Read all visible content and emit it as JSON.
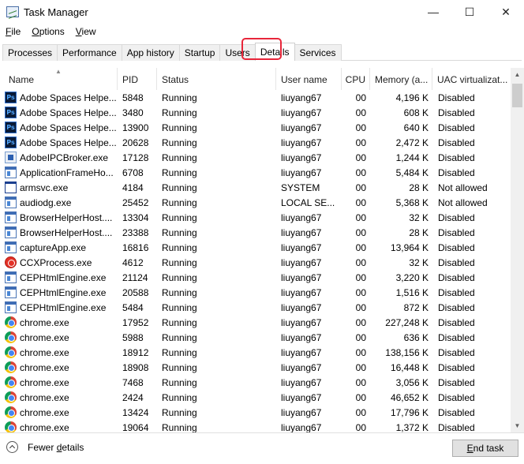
{
  "window": {
    "title": "Task Manager",
    "minimize": "—",
    "maximize": "☐",
    "close": "✕"
  },
  "menu": [
    {
      "pre": "",
      "u": "F",
      "post": "ile"
    },
    {
      "pre": "",
      "u": "O",
      "post": "ptions"
    },
    {
      "pre": "",
      "u": "V",
      "post": "iew"
    }
  ],
  "tabs": [
    "Processes",
    "Performance",
    "App history",
    "Startup",
    "Users",
    "Details",
    "Services"
  ],
  "active_tab": "Details",
  "columns": [
    "Name",
    "PID",
    "Status",
    "User name",
    "CPU",
    "Memory (a...",
    "UAC virtualizat..."
  ],
  "sort_indicator": "▲",
  "rows": [
    {
      "icon": "photoshop-icon",
      "name": "Adobe Spaces Helpe...",
      "pid": "5848",
      "status": "Running",
      "user": "liuyang67",
      "cpu": "00",
      "mem": "4,196 K",
      "uac": "Disabled"
    },
    {
      "icon": "photoshop-icon",
      "name": "Adobe Spaces Helpe...",
      "pid": "3480",
      "status": "Running",
      "user": "liuyang67",
      "cpu": "00",
      "mem": "608 K",
      "uac": "Disabled"
    },
    {
      "icon": "photoshop-icon",
      "name": "Adobe Spaces Helpe...",
      "pid": "13900",
      "status": "Running",
      "user": "liuyang67",
      "cpu": "00",
      "mem": "640 K",
      "uac": "Disabled"
    },
    {
      "icon": "photoshop-icon",
      "name": "Adobe Spaces Helpe...",
      "pid": "20628",
      "status": "Running",
      "user": "liuyang67",
      "cpu": "00",
      "mem": "2,472 K",
      "uac": "Disabled"
    },
    {
      "icon": "acrobat-icon",
      "name": "AdobeIPCBroker.exe",
      "pid": "17128",
      "status": "Running",
      "user": "liuyang67",
      "cpu": "00",
      "mem": "1,244 K",
      "uac": "Disabled"
    },
    {
      "icon": "window-app-icon",
      "name": "ApplicationFrameHo...",
      "pid": "6708",
      "status": "Running",
      "user": "liuyang67",
      "cpu": "00",
      "mem": "5,484 K",
      "uac": "Disabled"
    },
    {
      "icon": "service-window-icon",
      "name": "armsvc.exe",
      "pid": "4184",
      "status": "Running",
      "user": "SYSTEM",
      "cpu": "00",
      "mem": "28 K",
      "uac": "Not allowed"
    },
    {
      "icon": "window-app-icon",
      "name": "audiodg.exe",
      "pid": "25452",
      "status": "Running",
      "user": "LOCAL SE...",
      "cpu": "00",
      "mem": "5,368 K",
      "uac": "Not allowed"
    },
    {
      "icon": "window-app-icon",
      "name": "BrowserHelperHost....",
      "pid": "13304",
      "status": "Running",
      "user": "liuyang67",
      "cpu": "00",
      "mem": "32 K",
      "uac": "Disabled"
    },
    {
      "icon": "window-app-icon",
      "name": "BrowserHelperHost....",
      "pid": "23388",
      "status": "Running",
      "user": "liuyang67",
      "cpu": "00",
      "mem": "28 K",
      "uac": "Disabled"
    },
    {
      "icon": "window-app-icon",
      "name": "captureApp.exe",
      "pid": "16816",
      "status": "Running",
      "user": "liuyang67",
      "cpu": "00",
      "mem": "13,964 K",
      "uac": "Disabled"
    },
    {
      "icon": "creative-cloud-icon",
      "name": "CCXProcess.exe",
      "pid": "4612",
      "status": "Running",
      "user": "liuyang67",
      "cpu": "00",
      "mem": "32 K",
      "uac": "Disabled"
    },
    {
      "icon": "window-app-icon",
      "name": "CEPHtmlEngine.exe",
      "pid": "21124",
      "status": "Running",
      "user": "liuyang67",
      "cpu": "00",
      "mem": "3,220 K",
      "uac": "Disabled"
    },
    {
      "icon": "window-app-icon",
      "name": "CEPHtmlEngine.exe",
      "pid": "20588",
      "status": "Running",
      "user": "liuyang67",
      "cpu": "00",
      "mem": "1,516 K",
      "uac": "Disabled"
    },
    {
      "icon": "window-app-icon",
      "name": "CEPHtmlEngine.exe",
      "pid": "5484",
      "status": "Running",
      "user": "liuyang67",
      "cpu": "00",
      "mem": "872 K",
      "uac": "Disabled"
    },
    {
      "icon": "chrome-icon",
      "name": "chrome.exe",
      "pid": "17952",
      "status": "Running",
      "user": "liuyang67",
      "cpu": "00",
      "mem": "227,248 K",
      "uac": "Disabled"
    },
    {
      "icon": "chrome-icon",
      "name": "chrome.exe",
      "pid": "5988",
      "status": "Running",
      "user": "liuyang67",
      "cpu": "00",
      "mem": "636 K",
      "uac": "Disabled"
    },
    {
      "icon": "chrome-icon",
      "name": "chrome.exe",
      "pid": "18912",
      "status": "Running",
      "user": "liuyang67",
      "cpu": "00",
      "mem": "138,156 K",
      "uac": "Disabled"
    },
    {
      "icon": "chrome-icon",
      "name": "chrome.exe",
      "pid": "18908",
      "status": "Running",
      "user": "liuyang67",
      "cpu": "00",
      "mem": "16,448 K",
      "uac": "Disabled"
    },
    {
      "icon": "chrome-icon",
      "name": "chrome.exe",
      "pid": "7468",
      "status": "Running",
      "user": "liuyang67",
      "cpu": "00",
      "mem": "3,056 K",
      "uac": "Disabled"
    },
    {
      "icon": "chrome-icon",
      "name": "chrome.exe",
      "pid": "2424",
      "status": "Running",
      "user": "liuyang67",
      "cpu": "00",
      "mem": "46,652 K",
      "uac": "Disabled"
    },
    {
      "icon": "chrome-icon",
      "name": "chrome.exe",
      "pid": "13424",
      "status": "Running",
      "user": "liuyang67",
      "cpu": "00",
      "mem": "17,796 K",
      "uac": "Disabled"
    },
    {
      "icon": "chrome-icon",
      "name": "chrome.exe",
      "pid": "19064",
      "status": "Running",
      "user": "liuyang67",
      "cpu": "00",
      "mem": "1,372 K",
      "uac": "Disabled"
    }
  ],
  "footer": {
    "fewer_pre": "Fewer ",
    "fewer_u": "d",
    "fewer_post": "etails",
    "end_pre": "",
    "end_u": "E",
    "end_post": "nd task"
  },
  "colors": {
    "highlight": "#e8263a"
  }
}
